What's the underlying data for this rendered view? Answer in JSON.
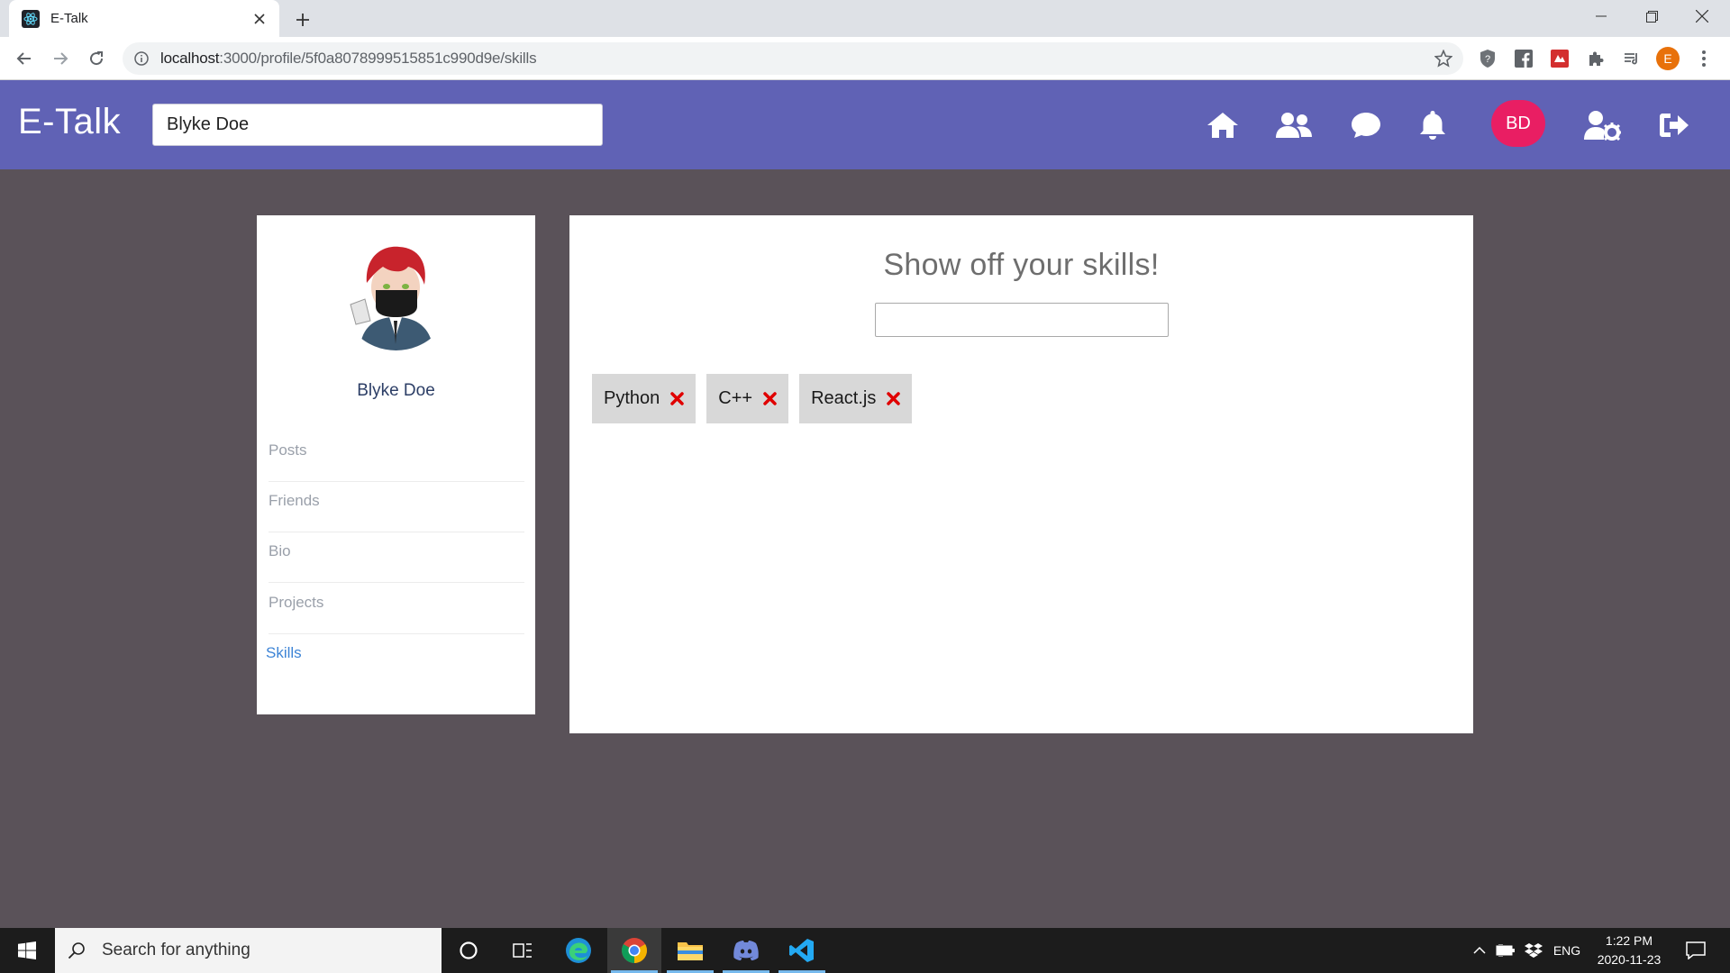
{
  "browser": {
    "tab_title": "E-Talk",
    "url_host": "localhost",
    "url_path": ":3000/profile/5f0a8078999515851c990d9e/skills",
    "profile_initial": "E"
  },
  "header": {
    "brand": "E-Talk",
    "search_value": "Blyke Doe",
    "user_initials": "BD",
    "nav_icons": [
      "home-icon",
      "friends-icon",
      "chat-icon",
      "bell-icon",
      "user-settings-icon",
      "logout-icon"
    ],
    "colors": {
      "header_bg": "#6062b5",
      "avatar_bg": "#e91e63"
    }
  },
  "sidebar": {
    "name": "Blyke Doe",
    "items": [
      {
        "label": "Posts"
      },
      {
        "label": "Friends"
      },
      {
        "label": "Bio"
      },
      {
        "label": "Projects"
      },
      {
        "label": "Skills",
        "active": true
      }
    ]
  },
  "main": {
    "title": "Show off your skills!",
    "input_value": "",
    "skills": [
      "Python",
      "C++",
      "React.js"
    ],
    "colors": {
      "remove_icon": "#e00000",
      "chip_bg": "#d8d8d8"
    }
  },
  "taskbar": {
    "search_placeholder": "Search for anything",
    "language": "ENG",
    "time": "1:22 PM",
    "date": "2020-11-23"
  }
}
